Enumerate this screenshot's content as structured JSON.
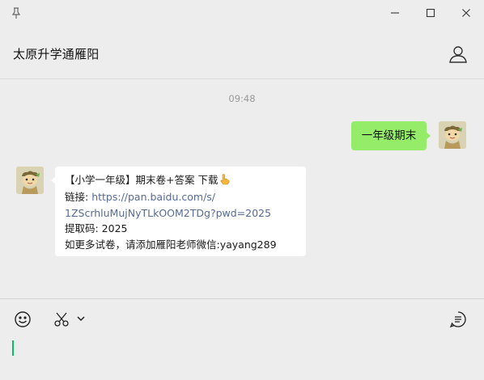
{
  "window": {
    "pin_icon": "pin-icon",
    "controls": [
      "minimize-icon",
      "maximize-icon",
      "close-icon"
    ]
  },
  "chat": {
    "title": "太原升学通雁阳",
    "contact_icon": "person-icon"
  },
  "messages": {
    "timestamp": "09:48",
    "outgoing": {
      "text": "一年级期末",
      "bubble_color": "#95ec69"
    },
    "incoming": {
      "line1": "【小学一年级】期末卷+答案 下载",
      "line1_emoji": "pointing-down-emoji",
      "line2_label": "链接: ",
      "line2_url": "https://pan.baidu.com/s/",
      "line3_url": "1ZScrhluMujNyTLkOOM2TDg?pwd=2025",
      "line4": "提取码: 2025",
      "line5": "如更多试卷，请添加雁阳老师微信:yayang289",
      "link_color": "#576b95"
    }
  },
  "composer": {
    "tools": [
      "emoji-icon",
      "scissors-icon",
      "chevron-down-icon",
      "chat-history-icon"
    ],
    "cursor_color": "#07c160"
  }
}
